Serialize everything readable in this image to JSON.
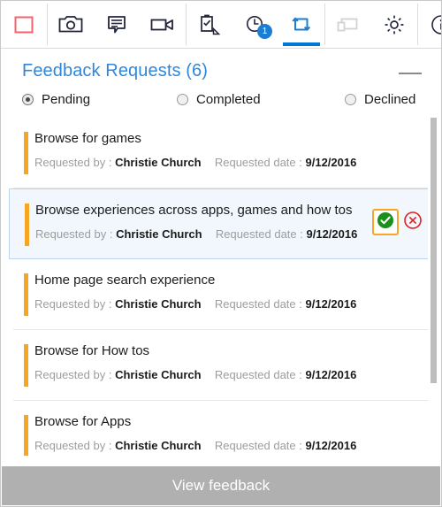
{
  "toolbar": {
    "items": [
      {
        "name": "capture-region-icon",
        "label": "Capture region",
        "state": "normal",
        "badge": null
      },
      {
        "name": "screenshot-camera-icon",
        "label": "Screenshot",
        "state": "normal",
        "badge": null
      },
      {
        "name": "comment-note-icon",
        "label": "Comment",
        "state": "normal",
        "badge": null
      },
      {
        "name": "video-record-icon",
        "label": "Record video",
        "state": "normal",
        "badge": null
      },
      {
        "name": "clipboard-check-icon",
        "label": "Test case",
        "state": "normal",
        "badge": null
      },
      {
        "name": "clock-history-icon",
        "label": "Pending items",
        "state": "normal",
        "badge": "1"
      },
      {
        "name": "feedback-request-icon",
        "label": "Feedback requests",
        "state": "selected",
        "badge": null
      },
      {
        "name": "device-monitor-icon",
        "label": "Devices",
        "state": "disabled",
        "badge": null
      },
      {
        "name": "gear-settings-icon",
        "label": "Settings",
        "state": "normal",
        "badge": null
      },
      {
        "name": "info-icon",
        "label": "About",
        "state": "normal",
        "badge": null
      }
    ]
  },
  "panel": {
    "title": "Feedback Requests (6)",
    "minimize_label": "Minimize",
    "filters": [
      {
        "label": "Pending",
        "checked": true
      },
      {
        "label": "Completed",
        "checked": false
      },
      {
        "label": "Declined",
        "checked": false
      }
    ]
  },
  "requests": {
    "requested_by_label": "Requested by :",
    "requested_date_label": "Requested date :",
    "approve_label": "Approve",
    "decline_label": "Decline",
    "items": [
      {
        "title": "Browse for games",
        "requested_by": "Christie Church",
        "requested_date": "9/12/2016",
        "selected": false
      },
      {
        "title": "Browse experiences across apps, games and how tos",
        "requested_by": "Christie Church",
        "requested_date": "9/12/2016",
        "selected": true
      },
      {
        "title": "Home page search experience",
        "requested_by": "Christie Church",
        "requested_date": "9/12/2016",
        "selected": false
      },
      {
        "title": "Browse for How tos",
        "requested_by": "Christie Church",
        "requested_date": "9/12/2016",
        "selected": false
      },
      {
        "title": "Browse for Apps",
        "requested_by": "Christie Church",
        "requested_date": "9/12/2016",
        "selected": false
      }
    ]
  },
  "footer": {
    "view_feedback_label": "View feedback"
  },
  "colors": {
    "accent_blue": "#0078d7",
    "title_blue": "#2f87dd",
    "orange_bar": "#f5a623",
    "approve_green": "#1a8f1a",
    "decline_red": "#e02020",
    "footer_gray": "#b0b0b0",
    "selected_row_bg": "#f2f7fd"
  }
}
